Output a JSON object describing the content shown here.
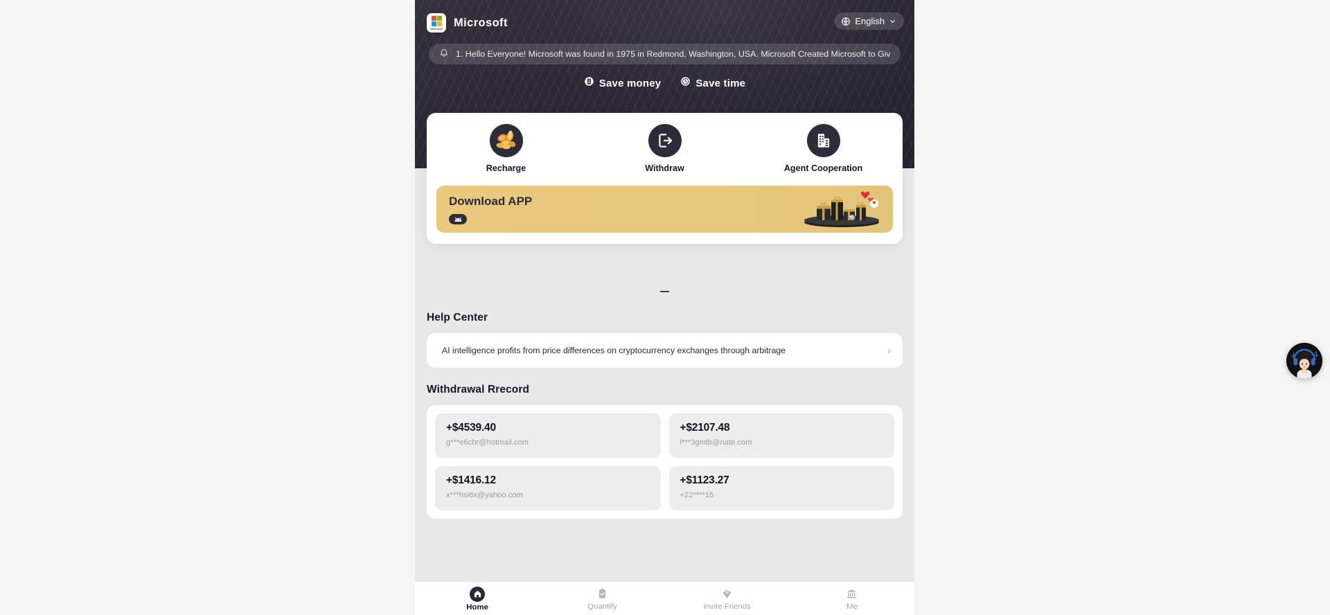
{
  "brand": {
    "name": "Microsoft",
    "logo_icon": "microsoft-logo-icon",
    "logo_word": "Microsoft"
  },
  "language_selector": {
    "label": "English",
    "globe_icon": "globe-icon",
    "chevron_icon": "chevron-down-icon"
  },
  "notice": {
    "bell_icon": "bell-icon",
    "text": "1. Hello Everyone! Microsoft was found in 1975 in Redmond, Washington, USA. Microsoft Created Microsoft to Giv"
  },
  "slogans": [
    {
      "label": "Save money",
      "icon": "money-bill-icon"
    },
    {
      "label": "Save time",
      "icon": "clock-icon"
    }
  ],
  "quick_actions": [
    {
      "label": "Recharge",
      "icon": "gold-coins-icon"
    },
    {
      "label": "Withdraw",
      "icon": "withdraw-arrow-icon"
    },
    {
      "label": "Agent Cooperation",
      "icon": "building-icon"
    }
  ],
  "banner": {
    "title": "Download APP",
    "badge_icon": "android-icon",
    "art_icon": "gift-boxes-icon",
    "bg_color": "#e7c87e"
  },
  "help_center": {
    "title": "Help Center",
    "items": [
      {
        "text": "AI intelligence profits from price differences on cryptocurrency exchanges through arbitrage",
        "chevron": "›"
      }
    ]
  },
  "withdrawal_record": {
    "title": "Withdrawal Rrecord",
    "items": [
      {
        "amount": "+$4539.40",
        "account": "g***e6chr@hotmail.com"
      },
      {
        "amount": "+$2107.48",
        "account": "l***3gmtb@nate.com"
      },
      {
        "amount": "+$1416.12",
        "account": "x***hsi6x@yahoo.com"
      },
      {
        "amount": "+$1123.27",
        "account": "+22****15"
      }
    ]
  },
  "tabbar": {
    "tabs": [
      {
        "label": "Home",
        "icon": "home-icon",
        "active": true
      },
      {
        "label": "Quantify",
        "icon": "clipboard-check-icon",
        "active": false
      },
      {
        "label": "Invite Friends",
        "icon": "diamond-icon",
        "active": false
      },
      {
        "label": "Me",
        "icon": "bank-icon",
        "active": false
      }
    ]
  },
  "support_widget": {
    "icon": "customer-service-avatar-icon"
  },
  "colors": {
    "header_dark": "#2b2834",
    "page_bg": "#e8e8e8",
    "accent_gold": "#e7c87e",
    "text_dark": "#16162b"
  }
}
